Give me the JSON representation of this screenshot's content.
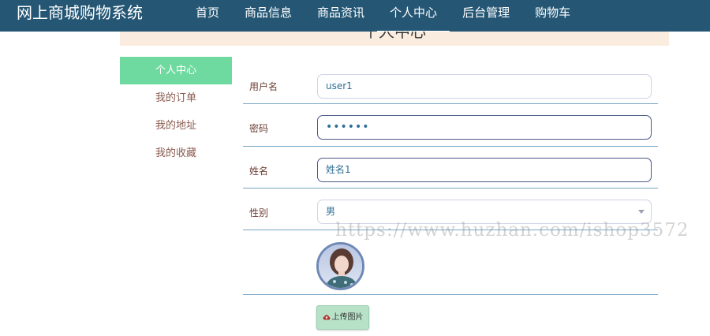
{
  "app": {
    "title": "网上商城购物系统"
  },
  "nav": {
    "items": [
      {
        "label": "首页"
      },
      {
        "label": "商品信息"
      },
      {
        "label": "商品资讯"
      },
      {
        "label": "个人中心"
      },
      {
        "label": "后台管理"
      },
      {
        "label": "购物车"
      }
    ],
    "active": "个人中心"
  },
  "page": {
    "title": "个人中心"
  },
  "sidebar": {
    "items": [
      {
        "label": "个人中心"
      },
      {
        "label": "我的订单"
      },
      {
        "label": "我的地址"
      },
      {
        "label": "我的收藏"
      }
    ],
    "active": "个人中心"
  },
  "form": {
    "username": {
      "label": "用户名",
      "value": "user1"
    },
    "password": {
      "label": "密码",
      "value": "••••••"
    },
    "name": {
      "label": "姓名",
      "value": "姓名1"
    },
    "gender": {
      "label": "性别",
      "value": "男"
    },
    "avatar": {
      "icon": "user-avatar-photo"
    },
    "upload": {
      "label": "上传图片",
      "icon": "cloud-upload-icon"
    }
  },
  "watermark": {
    "text": "https://www.huzhan.com/ishop3572"
  },
  "colors": {
    "topbar": "#255775",
    "sidebar_active": "#6fdaa0",
    "header_band": "#fbece0",
    "row_divider": "#7aa6c6",
    "upload_button": "#b7e2c8"
  }
}
